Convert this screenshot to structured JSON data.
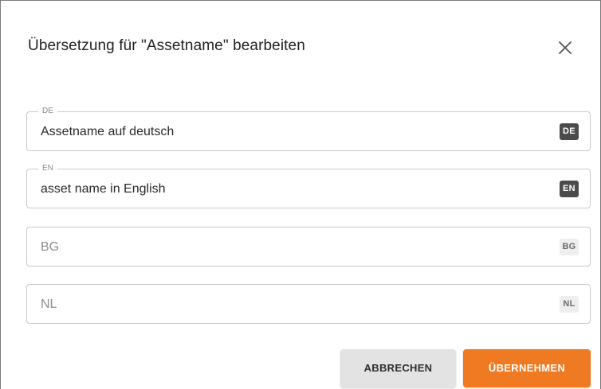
{
  "dialog": {
    "title": "Übersetzung für \"Assetname\" bearbeiten",
    "close_icon": "close-icon"
  },
  "fields": [
    {
      "legend": "DE",
      "value": "Assetname auf deutsch",
      "badge": "DE",
      "badge_active": true
    },
    {
      "legend": "EN",
      "value": "asset name in English",
      "badge": "EN",
      "badge_active": true
    },
    {
      "legend": "",
      "placeholder": "BG",
      "value": "",
      "badge": "BG",
      "badge_active": false
    },
    {
      "legend": "",
      "placeholder": "NL",
      "value": "",
      "badge": "NL",
      "badge_active": false
    }
  ],
  "buttons": {
    "cancel_label": "ABBRECHEN",
    "apply_label": "ÜBERNEHMEN"
  },
  "colors": {
    "accent": "#f07a22",
    "badge_active": "#4b4b4b",
    "badge_inactive": "#eeeeee"
  }
}
